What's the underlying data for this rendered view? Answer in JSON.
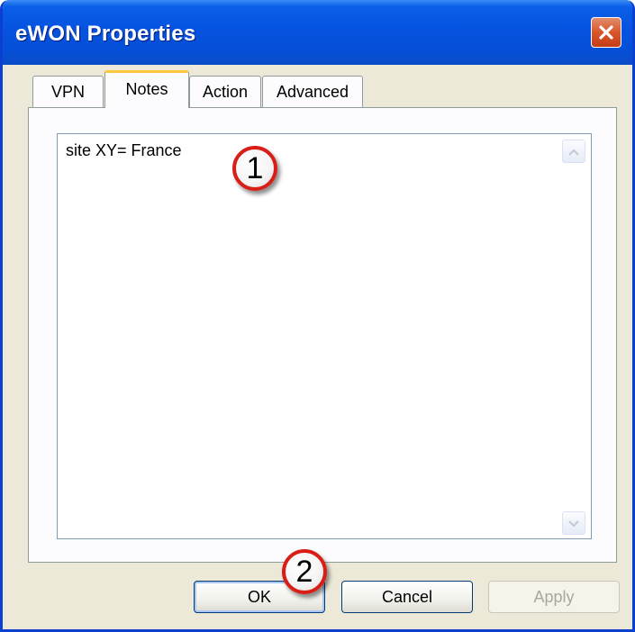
{
  "window": {
    "title": "eWON Properties"
  },
  "tabs": [
    {
      "label": "VPN",
      "active": false
    },
    {
      "label": "Notes",
      "active": true
    },
    {
      "label": "Action",
      "active": false
    },
    {
      "label": "Advanced",
      "active": false
    }
  ],
  "notes": {
    "value": "site XY= France"
  },
  "buttons": {
    "ok_label": "OK",
    "cancel_label": "Cancel",
    "apply_label": "Apply"
  },
  "callouts": {
    "first": "1",
    "second": "2"
  },
  "icons": {
    "close": "close-icon",
    "scroll_up": "arrow-up-icon",
    "scroll_down": "arrow-down-icon"
  },
  "colors": {
    "titlebar": "#0653e0",
    "window_bg": "#ece9d8",
    "active_tab_accent": "#ffc83c",
    "callout_ring": "#d81e16",
    "close_button": "#d9562c"
  }
}
